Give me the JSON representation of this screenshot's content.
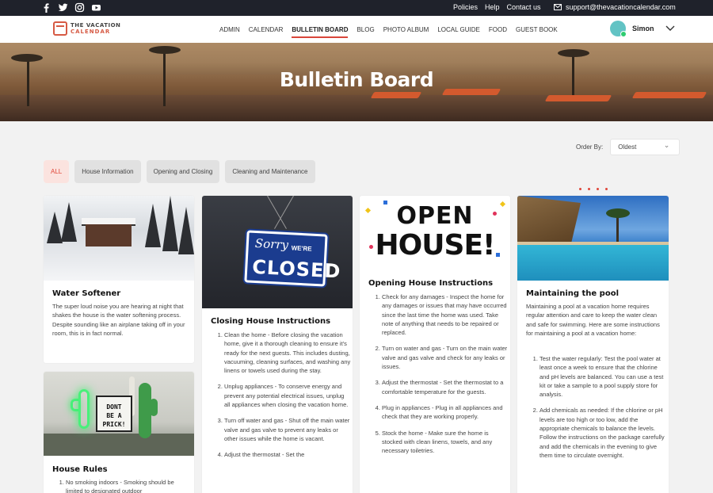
{
  "topbar": {
    "social_icons": [
      "facebook-icon",
      "twitter-icon",
      "instagram-icon",
      "youtube-icon"
    ],
    "links": [
      "Policies",
      "Help",
      "Contact us"
    ],
    "email": "support@thevacationcalendar.com"
  },
  "nav": {
    "logo_line1": "THE VACATION",
    "logo_line2": "CALENDAR",
    "items": [
      "ADMIN",
      "CALENDAR",
      "BULLETIN BOARD",
      "BLOG",
      "PHOTO ALBUM",
      "LOCAL GUIDE",
      "FOOD",
      "GUEST BOOK"
    ],
    "active_item": "BULLETIN BOARD",
    "user_name": "Simon"
  },
  "hero": {
    "title": "Bulletin Board"
  },
  "sort": {
    "label": "Order By:",
    "value": "Oldest"
  },
  "filters": [
    "ALL",
    "House Information",
    "Opening and Closing",
    "Cleaning and Maintenance"
  ],
  "active_filter": "ALL",
  "cards": {
    "water_softener": {
      "title": "Water Softener",
      "text": "The super loud noise you are hearing at night that shakes the house is the water softening process. Despite sounding like an airplane taking off in your room, this is in fact normal."
    },
    "house_rules": {
      "title": "House Rules",
      "items": [
        "No smoking indoors - Smoking should be limited to designated outdoor"
      ]
    },
    "closing": {
      "title": "Closing House Instructions",
      "image_text": {
        "sorry": "Sorry",
        "were": "WE'RE",
        "closed": "CLOSED"
      },
      "items": [
        "Clean the home - Before closing the vacation home, give it a thorough cleaning to ensure it's ready for the next guests. This includes dusting, vacuuming, cleaning surfaces, and washing any linens or towels used during the stay.",
        "Unplug appliances - To conserve energy and prevent any potential electrical issues, unplug all appliances when closing the vacation home.",
        "Turn off water and gas - Shut off the main water valve and gas valve to prevent any leaks or other issues while the home is vacant.",
        "Adjust the thermostat - Set the"
      ]
    },
    "opening": {
      "title": "Opening House Instructions",
      "image_text": {
        "line1": "OPEN",
        "line2": "HOUSE!"
      },
      "items": [
        "Check for any damages - Inspect the home for any damages or issues that may have occurred since the last time the home was used. Take note of anything that needs to be repaired or replaced.",
        "Turn on water and gas - Turn on the main water valve and gas valve and check for any leaks or issues.",
        "Adjust the thermostat - Set the thermostat to a comfortable temperature for the guests.",
        "Plug in appliances - Plug in all appliances and check that they are working properly.",
        "Stock the home - Make sure the home is stocked with clean linens, towels, and any necessary toiletries."
      ]
    },
    "pool": {
      "title": "Maintaining the pool",
      "text": "Maintaining a pool at a vacation home requires regular attention and care to keep the water clean and safe for swimming. Here are some instructions for maintaining a pool at a vacation home:",
      "items": [
        "Test the water regularly: Test the pool water at least once a week to ensure that the chlorine and pH levels are balanced. You can use a test kit or take a sample to a pool supply store for analysis.",
        "Add chemicals as needed: If the chlorine or pH levels are too high or too low, add the appropriate chemicals to balance the levels. Follow the instructions on the package carefully and add the chemicals in the evening to give them time to circulate overnight."
      ]
    },
    "cactus_sign": {
      "line1": "DONT",
      "line2": "BE A",
      "line3": "PRICK!"
    }
  },
  "colors": {
    "accent": "#e0473a",
    "topbar": "#1f222b",
    "neon": "#48f07a"
  }
}
